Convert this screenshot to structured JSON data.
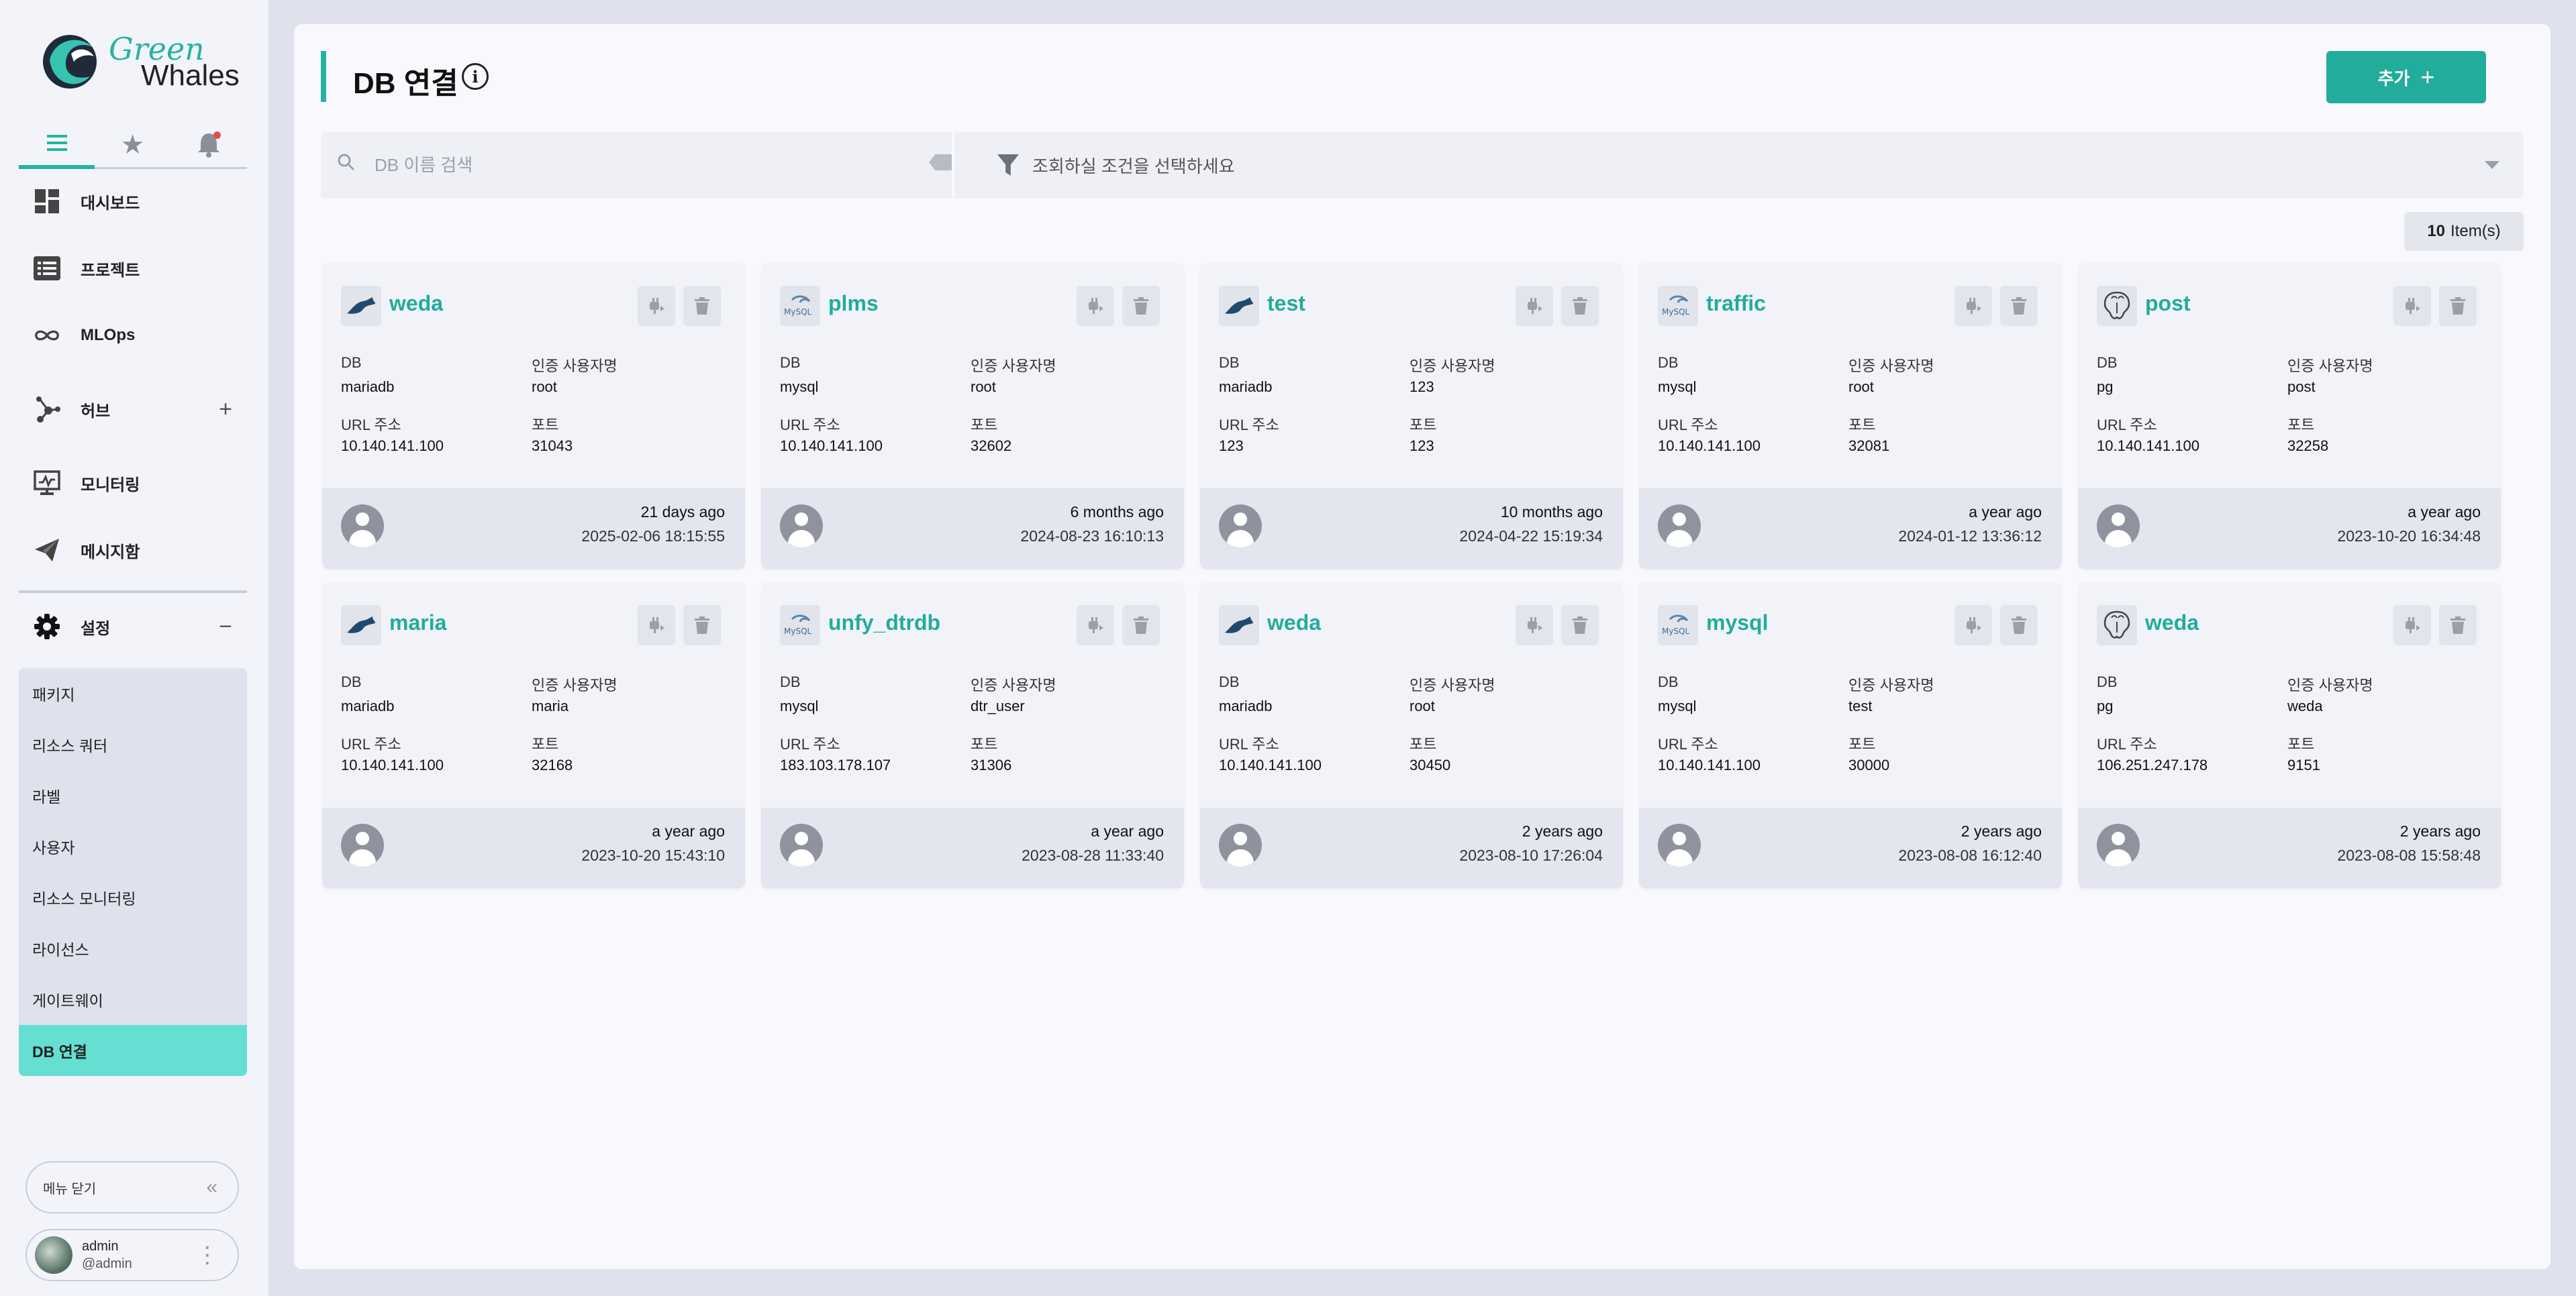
{
  "brand": {
    "line1": "Green",
    "line2": "Whales"
  },
  "sidebar": {
    "nav": [
      {
        "label": "대시보드",
        "icon": "dashboard-icon"
      },
      {
        "label": "프로젝트",
        "icon": "list-icon"
      },
      {
        "label": "MLOps",
        "icon": "infinity-icon"
      },
      {
        "label": "허브",
        "icon": "hub-icon",
        "expand": "+"
      },
      {
        "label": "모니터링",
        "icon": "monitor-icon"
      },
      {
        "label": "메시지함",
        "icon": "send-icon"
      }
    ],
    "settings": {
      "label": "설정",
      "collapse": "−"
    },
    "sub_items": [
      {
        "label": "패키지"
      },
      {
        "label": "리소스 쿼터"
      },
      {
        "label": "라벨"
      },
      {
        "label": "사용자"
      },
      {
        "label": "리소스 모니터링"
      },
      {
        "label": "라이선스"
      },
      {
        "label": "게이트웨이"
      },
      {
        "label": "DB 연결",
        "active": true
      }
    ],
    "collapse_label": "메뉴 닫기",
    "user": {
      "name": "admin",
      "handle": "@admin"
    }
  },
  "page": {
    "title": "DB 연결",
    "add_label": "추가",
    "search_placeholder": "DB 이름 검색",
    "filter_placeholder": "조회하실 조건을 선택하세요",
    "count_number": "10",
    "count_suffix": "Item(s)"
  },
  "labels": {
    "db": "DB",
    "auth_user": "인증 사용자명",
    "url": "URL 주소",
    "port": "포트"
  },
  "cards": [
    {
      "name": "weda",
      "db": "mariadb",
      "user": "root",
      "url": "10.140.141.100",
      "port": "31043",
      "relative": "21 days ago",
      "datetime": "2025-02-06 18:15:55"
    },
    {
      "name": "plms",
      "db": "mysql",
      "user": "root",
      "url": "10.140.141.100",
      "port": "32602",
      "relative": "6 months ago",
      "datetime": "2024-08-23 16:10:13"
    },
    {
      "name": "test",
      "db": "mariadb",
      "user": "123",
      "url": "123",
      "port": "123",
      "relative": "10 months ago",
      "datetime": "2024-04-22 15:19:34"
    },
    {
      "name": "traffic",
      "db": "mysql",
      "user": "root",
      "url": "10.140.141.100",
      "port": "32081",
      "relative": "a year ago",
      "datetime": "2024-01-12 13:36:12"
    },
    {
      "name": "post",
      "db": "pg",
      "user": "post",
      "url": "10.140.141.100",
      "port": "32258",
      "relative": "a year ago",
      "datetime": "2023-10-20 16:34:48"
    },
    {
      "name": "maria",
      "db": "mariadb",
      "user": "maria",
      "url": "10.140.141.100",
      "port": "32168",
      "relative": "a year ago",
      "datetime": "2023-10-20 15:43:10"
    },
    {
      "name": "unfy_dtrdb",
      "db": "mysql",
      "user": "dtr_user",
      "url": "183.103.178.107",
      "port": "31306",
      "relative": "a year ago",
      "datetime": "2023-08-28 11:33:40"
    },
    {
      "name": "weda",
      "db": "mariadb",
      "user": "root",
      "url": "10.140.141.100",
      "port": "30450",
      "relative": "2 years ago",
      "datetime": "2023-08-10 17:26:04"
    },
    {
      "name": "mysql",
      "db": "mysql",
      "user": "test",
      "url": "10.140.141.100",
      "port": "30000",
      "relative": "2 years ago",
      "datetime": "2023-08-08 16:12:40"
    },
    {
      "name": "weda",
      "db": "pg",
      "user": "weda",
      "url": "106.251.247.178",
      "port": "9151",
      "relative": "2 years ago",
      "datetime": "2023-08-08 15:58:48"
    }
  ],
  "colors": {
    "accent": "#22ac9b",
    "active_menu": "#64dfd2"
  }
}
